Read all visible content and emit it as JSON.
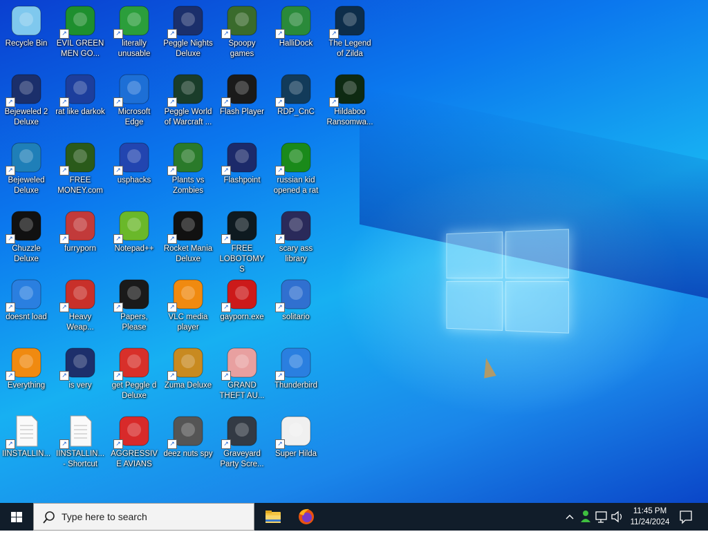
{
  "desktop": {
    "icons": [
      {
        "label": "Recycle Bin",
        "icon": "recycle-bin-icon",
        "color": "#7fc8ee"
      },
      {
        "label": "EVIL GREEN MEN GO...",
        "icon": "green-men-icon",
        "color": "#1e8f2e"
      },
      {
        "label": "literally unusable",
        "icon": "chrome-icon",
        "color": "#2b9e3b"
      },
      {
        "label": "Peggle Nights Deluxe",
        "icon": "peggle-nights-icon",
        "color": "#1b2f6b"
      },
      {
        "label": "Spoopy games",
        "icon": "spoopy-games-icon",
        "color": "#3a6b2c"
      },
      {
        "label": "HalliDock",
        "icon": "shield-icon",
        "color": "#2a8a3a"
      },
      {
        "label": "The Legend of Zilda",
        "icon": "zilda-icon",
        "color": "#0d2d4a"
      },
      {
        "label": "Bejeweled 2 Deluxe",
        "icon": "bejeweled2-icon",
        "color": "#1b2f6b"
      },
      {
        "label": "rat like darkok",
        "icon": "mpl-icon",
        "color": "#1d3e9c"
      },
      {
        "label": "Microsoft Edge",
        "icon": "edge-icon",
        "color": "#1d6fd6"
      },
      {
        "label": "Peggle World of Warcraft ...",
        "icon": "peggle-wow-icon",
        "color": "#1a3d2a"
      },
      {
        "label": "Flash Player",
        "icon": "flash-player-icon",
        "color": "#1a1a1a"
      },
      {
        "label": "RDP_CnC",
        "icon": "rdp-icon",
        "color": "#123b5a"
      },
      {
        "label": "Hildaboo Ransomwa...",
        "icon": "ransomware-icon",
        "color": "#0e2a12"
      },
      {
        "label": "Bejeweled Deluxe",
        "icon": "bejeweled-icon",
        "color": "#1f7fb8"
      },
      {
        "label": "FREE MONEY.com",
        "icon": "money-bag-icon",
        "color": "#2a5a1a"
      },
      {
        "label": "usphacks",
        "icon": "mpl-hacks-icon",
        "color": "#2245b0"
      },
      {
        "label": "Plants vs Zombies",
        "icon": "plants-icon",
        "color": "#2a7a2a"
      },
      {
        "label": "Flashpoint",
        "icon": "flashpoint-icon",
        "color": "#1c2a6a"
      },
      {
        "label": "russian kid opened a rat",
        "icon": "rat-icon",
        "color": "#1a8a1a"
      },
      {
        "label": "Chuzzle Deluxe",
        "icon": "chuzzle-icon",
        "color": "#111111"
      },
      {
        "label": "furryporn",
        "icon": "globe-icon",
        "color": "#c23a3a"
      },
      {
        "label": "Notepad++",
        "icon": "notepad-plus-icon",
        "color": "#6ab82a"
      },
      {
        "label": "Rocket Mania Deluxe",
        "icon": "rocket-mania-icon",
        "color": "#111111"
      },
      {
        "label": "FREE LOBOTOMYS",
        "icon": "lobotomy-icon",
        "color": "#0e1a20"
      },
      {
        "label": "scary ass library",
        "icon": "library-icon",
        "color": "#2a2a5a"
      },
      {
        "label": "doesnt load",
        "icon": "thunderbird-icon",
        "color": "#2a7fe0"
      },
      {
        "label": "Heavy Weap...",
        "icon": "radiation-icon",
        "color": "#c8302a"
      },
      {
        "label": "Papers, Please",
        "icon": "papers-please-icon",
        "color": "#1a1a1a"
      },
      {
        "label": "VLC media player",
        "icon": "vlc-icon",
        "color": "#f08a10"
      },
      {
        "label": "gayporn.exe",
        "icon": "flash-icon",
        "color": "#cc1a1a"
      },
      {
        "label": "solitario",
        "icon": "solitaire-icon",
        "color": "#3070d0"
      },
      {
        "label": "Everything",
        "icon": "search-magnifier-icon",
        "color": "#f08a10"
      },
      {
        "label": "is very",
        "icon": "mpl-shield-icon",
        "color": "#1d2f6b"
      },
      {
        "label": "get Peggle d Deluxe",
        "icon": "peggle-icon",
        "color": "#d8302a"
      },
      {
        "label": "Zuma Deluxe",
        "icon": "zuma-icon",
        "color": "#c88a20"
      },
      {
        "label": "GRAND THEFT AU...",
        "icon": "anime-girl-icon",
        "color": "#e8a0a0"
      },
      {
        "label": "Thunderbird",
        "icon": "thunderbird-icon",
        "color": "#2a7fe0"
      },
      {
        "label": "IINSTALLIN...",
        "icon": "text-document-icon",
        "color": "#f4f4f4"
      },
      {
        "label": "IINSTALLIN... - Shortcut",
        "icon": "text-document-icon",
        "color": "#f4f4f4"
      },
      {
        "label": "AGGRESSIVE AVIANS",
        "icon": "angry-bird-icon",
        "color": "#d82a2a"
      },
      {
        "label": "deez nuts spy",
        "icon": "windows-stack-icon",
        "color": "#555555"
      },
      {
        "label": "Graveyard Party Scre...",
        "icon": "graveyard-icon",
        "color": "#333a44"
      },
      {
        "label": "Super Hilda",
        "icon": "super-hilda-icon",
        "color": "#f0f0f0"
      }
    ]
  },
  "taskbar": {
    "search_placeholder": "Type here to search",
    "pinned": [
      {
        "name": "File Explorer",
        "icon": "folder-icon"
      },
      {
        "name": "Firefox",
        "icon": "firefox-icon"
      }
    ],
    "time": "11:45 PM",
    "date": "11/24/2024"
  }
}
